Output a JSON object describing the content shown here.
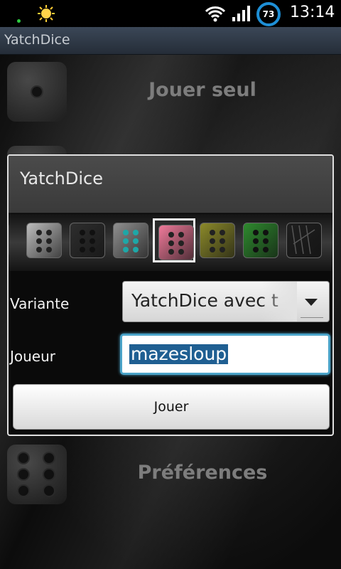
{
  "status_bar": {
    "battery_level": "73",
    "time": "13:14",
    "icons": [
      "notification-dot-icon",
      "weather-sun-icon",
      "wifi-icon",
      "signal-icon",
      "battery-icon"
    ]
  },
  "app": {
    "title": "YatchDice"
  },
  "menu": {
    "play_solo_label": "Jouer seul",
    "preferences_label": "Préférences"
  },
  "dialog": {
    "title": "YatchDice",
    "dice_skins": [
      {
        "name": "grey",
        "selected": false,
        "color": "#bdbdbd"
      },
      {
        "name": "dark",
        "selected": false,
        "color": "#2e2e2e"
      },
      {
        "name": "teal",
        "selected": false,
        "color": "#8f8f8f"
      },
      {
        "name": "pink",
        "selected": true,
        "color": "#f07a9a"
      },
      {
        "name": "olive",
        "selected": false,
        "color": "#8c8a2a"
      },
      {
        "name": "green",
        "selected": false,
        "color": "#2e8a2e"
      },
      {
        "name": "scratched",
        "selected": false,
        "color": "#1f1f1f"
      }
    ],
    "variant_label": "Variante",
    "variant_value": "YatchDice avec t",
    "player_label": "Joueur",
    "player_value": "mazesloup",
    "play_button_label": "Jouer"
  },
  "colors": {
    "accent": "#4aa3c8",
    "selection": "#1f5f92",
    "battery_ring": "#1e8fd6"
  }
}
